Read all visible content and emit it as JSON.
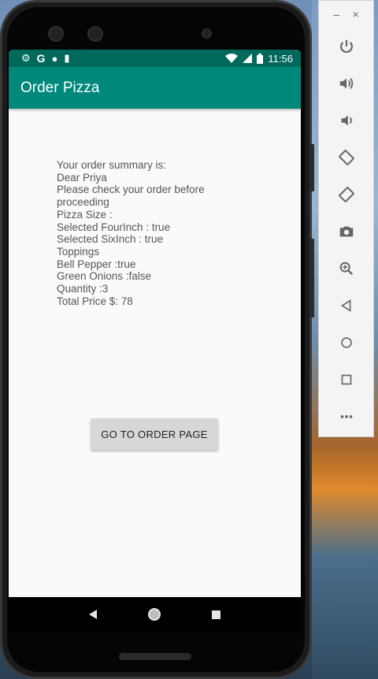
{
  "status_bar": {
    "time": "11:56",
    "left_icons": [
      "settings-icon",
      "google-icon",
      "circle-app-icon",
      "sd-card-icon"
    ],
    "right_icons": [
      "wifi-icon",
      "signal-icon",
      "battery-icon"
    ]
  },
  "app_bar": {
    "title": "Order Pizza"
  },
  "summary_lines": [
    "Your order summary is:",
    "Dear Priya",
    "Please check your order before proceeding",
    "Pizza Size :",
    "Selected FourInch : true",
    "Selected SixInch : true",
    "Toppings",
    "Bell Pepper :true",
    "Green Onions :false",
    "Quantity :3",
    "Total Price $: 78"
  ],
  "button": {
    "label": "GO TO ORDER PAGE"
  },
  "nav_bar": {
    "icons": [
      "back-icon",
      "home-icon",
      "recents-icon"
    ]
  },
  "emulator": {
    "window_controls": [
      "minimize-icon",
      "close-icon"
    ],
    "tools": [
      "power-icon",
      "volume-up-icon",
      "volume-down-icon",
      "rotate-left-icon",
      "rotate-right-icon",
      "camera-icon",
      "zoom-icon",
      "back-icon",
      "home-icon",
      "overview-icon",
      "more-icon"
    ]
  },
  "colors": {
    "status_bar": "#00695c",
    "app_bar": "#00897b",
    "button": "#d6d7d7"
  }
}
